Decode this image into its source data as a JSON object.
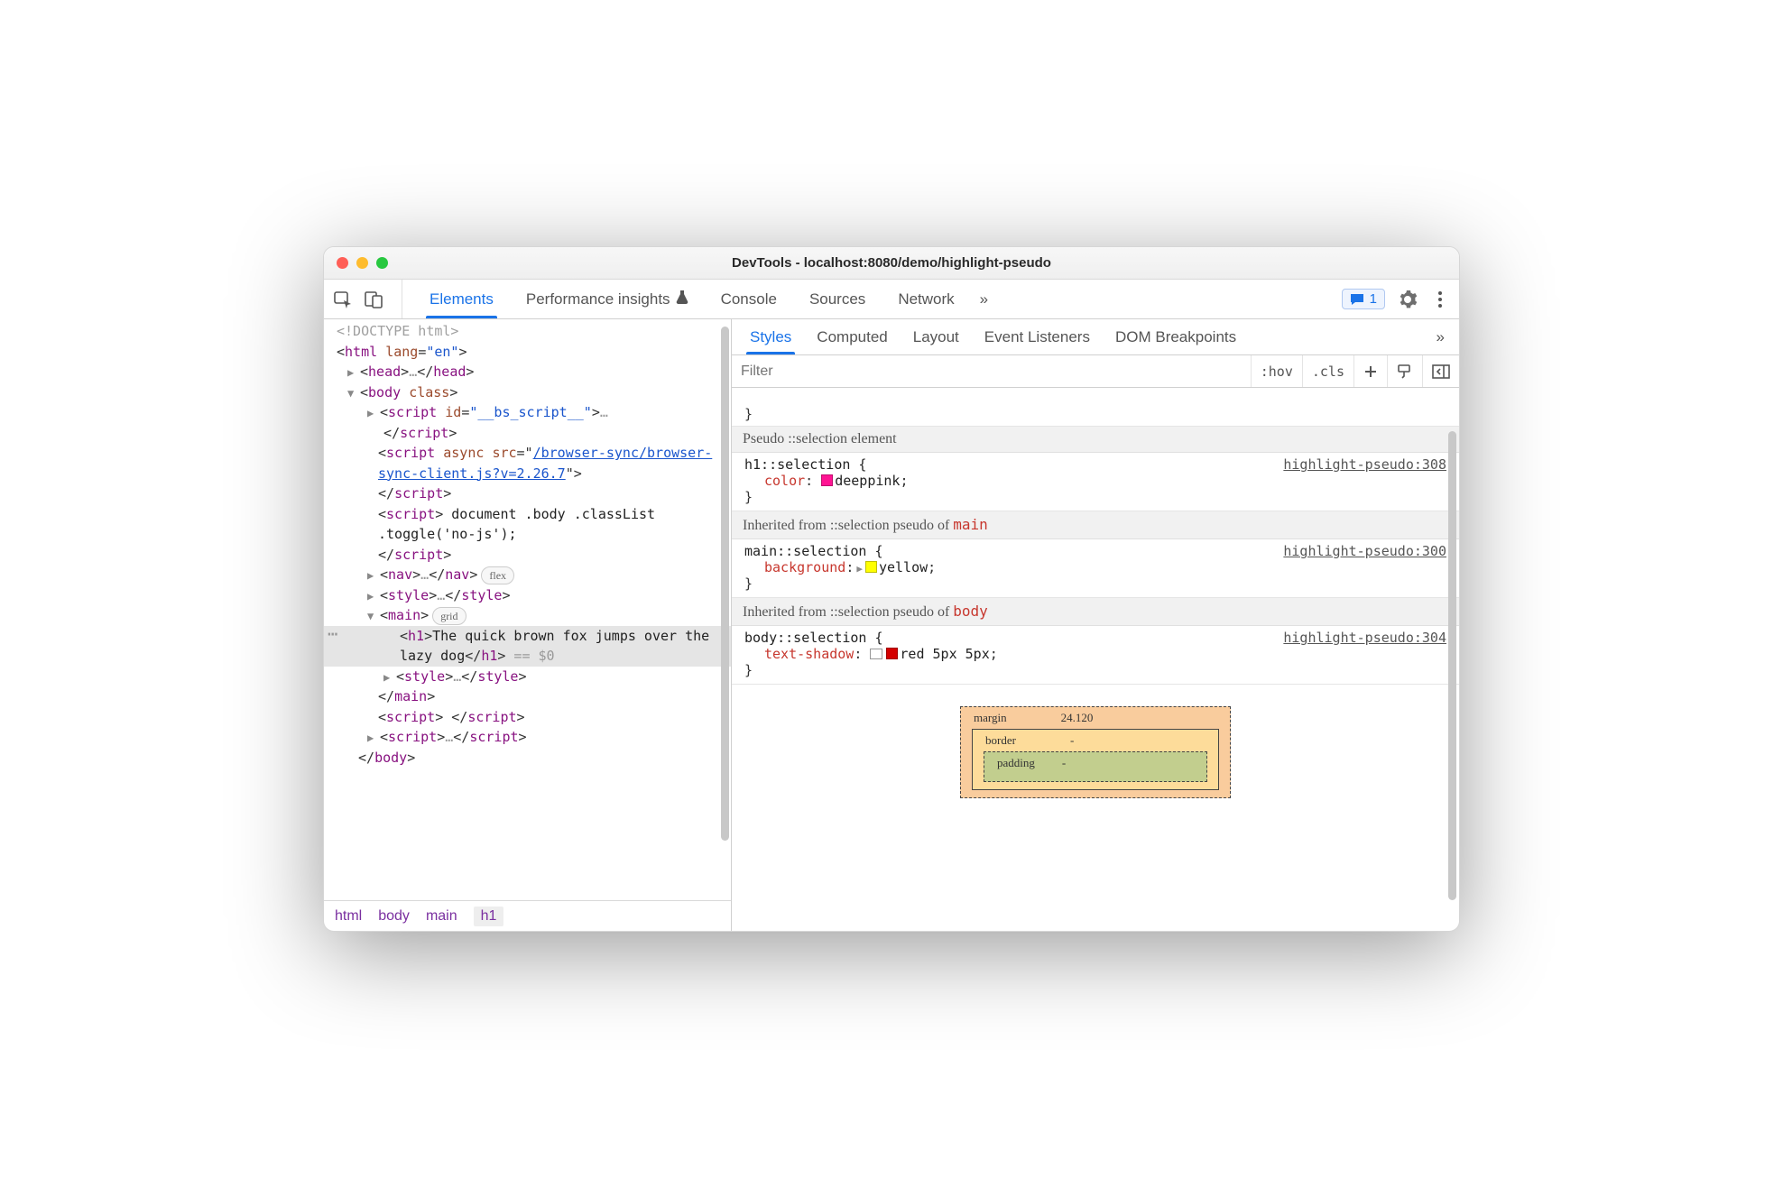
{
  "window": {
    "title": "DevTools - localhost:8080/demo/highlight-pseudo"
  },
  "toolbar": {
    "tabs": [
      "Elements",
      "Performance insights",
      "Console",
      "Sources",
      "Network"
    ],
    "active_tab_index": 0,
    "overflow_glyph": "»",
    "badge_count": "1"
  },
  "dom": {
    "doctype": "<!DOCTYPE html>",
    "html_open": "html",
    "html_lang_attr": "lang",
    "html_lang_val": "\"en\"",
    "head_open": "head",
    "head_ellipsis": "…",
    "body_open": "body",
    "body_class_attr": "class",
    "script_bs_id_attr": "id",
    "script_bs_id_val": "\"__bs_script__\"",
    "script_bs_ellipsis": "…",
    "close_script": "script",
    "script_async_attr": "async",
    "script_src_attr": "src",
    "script_src_val": "/browser-sync/browser-sync-client.js?v=2.26.7",
    "script_inline_text": " document .body .classList .toggle('no-js');",
    "nav_open": "nav",
    "nav_pill": "flex",
    "style_open": "style",
    "main_open": "main",
    "main_pill": "grid",
    "h1_open": "h1",
    "h1_text": "The quick brown fox jumps over the lazy dog",
    "selected_suffix": " == $0",
    "close_main": "main",
    "close_body": "body"
  },
  "breadcrumb": [
    "html",
    "body",
    "main",
    "h1"
  ],
  "styles": {
    "tabs": [
      "Styles",
      "Computed",
      "Layout",
      "Event Listeners",
      "DOM Breakpoints"
    ],
    "active_tab_index": 0,
    "overflow_glyph": "»",
    "filter_placeholder": "Filter",
    "hov": ":hov",
    "cls": ".cls",
    "cut_brace": "}",
    "sections": [
      {
        "header": "Pseudo ::selection element",
        "rule": {
          "selector": "h1::selection {",
          "src": "highlight-pseudo:308",
          "prop_name": "color",
          "value_text": "deeppink",
          "swatch": "#ff1493",
          "close": "}"
        }
      },
      {
        "header_prefix": "Inherited from ::selection pseudo of ",
        "header_tag": "main",
        "rule": {
          "selector": "main::selection {",
          "src": "highlight-pseudo:300",
          "prop_name": "background",
          "value_text": "yellow",
          "swatch": "#ffff00",
          "expandable": true,
          "close": "}"
        }
      },
      {
        "header_prefix": "Inherited from ::selection pseudo of ",
        "header_tag": "body",
        "rule": {
          "selector": "body::selection {",
          "src": "highlight-pseudo:304",
          "prop_name": "text-shadow",
          "value_text": "red 5px 5px",
          "swatch": "#d40000",
          "shadow_icon": true,
          "close": "}"
        }
      }
    ],
    "boxmodel": {
      "margin_label": "margin",
      "margin_top": "24.120",
      "border_label": "border",
      "border_top": "-",
      "padding_label": "padding",
      "padding_top": "-"
    }
  }
}
